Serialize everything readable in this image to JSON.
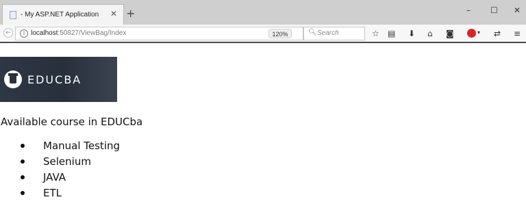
{
  "browser": {
    "tab": {
      "title": "- My ASP.NET Application",
      "close_glyph": "✕"
    },
    "new_tab_glyph": "+",
    "window_controls": [
      "–",
      "☐",
      "✕"
    ],
    "address": {
      "host": "localhost",
      "rest": ":50827/ViewBag/Index"
    },
    "zoom": "120%",
    "search_placeholder": "Search",
    "toolbar_icons": [
      "star-icon",
      "reading-list-icon",
      "download-icon",
      "home-icon",
      "pocket-icon",
      "adblock-icon",
      "extension-icon",
      "menu-icon"
    ]
  },
  "page": {
    "logo_text": "EDUCBA",
    "heading": "Available course in EDUCba",
    "courses": [
      "Manual Testing",
      "Selenium",
      "JAVA",
      "ETL"
    ]
  },
  "colors": {
    "tabbar": "#cfcfcf",
    "logo_bg": "#2e3744",
    "adblock": "#d9262c"
  }
}
